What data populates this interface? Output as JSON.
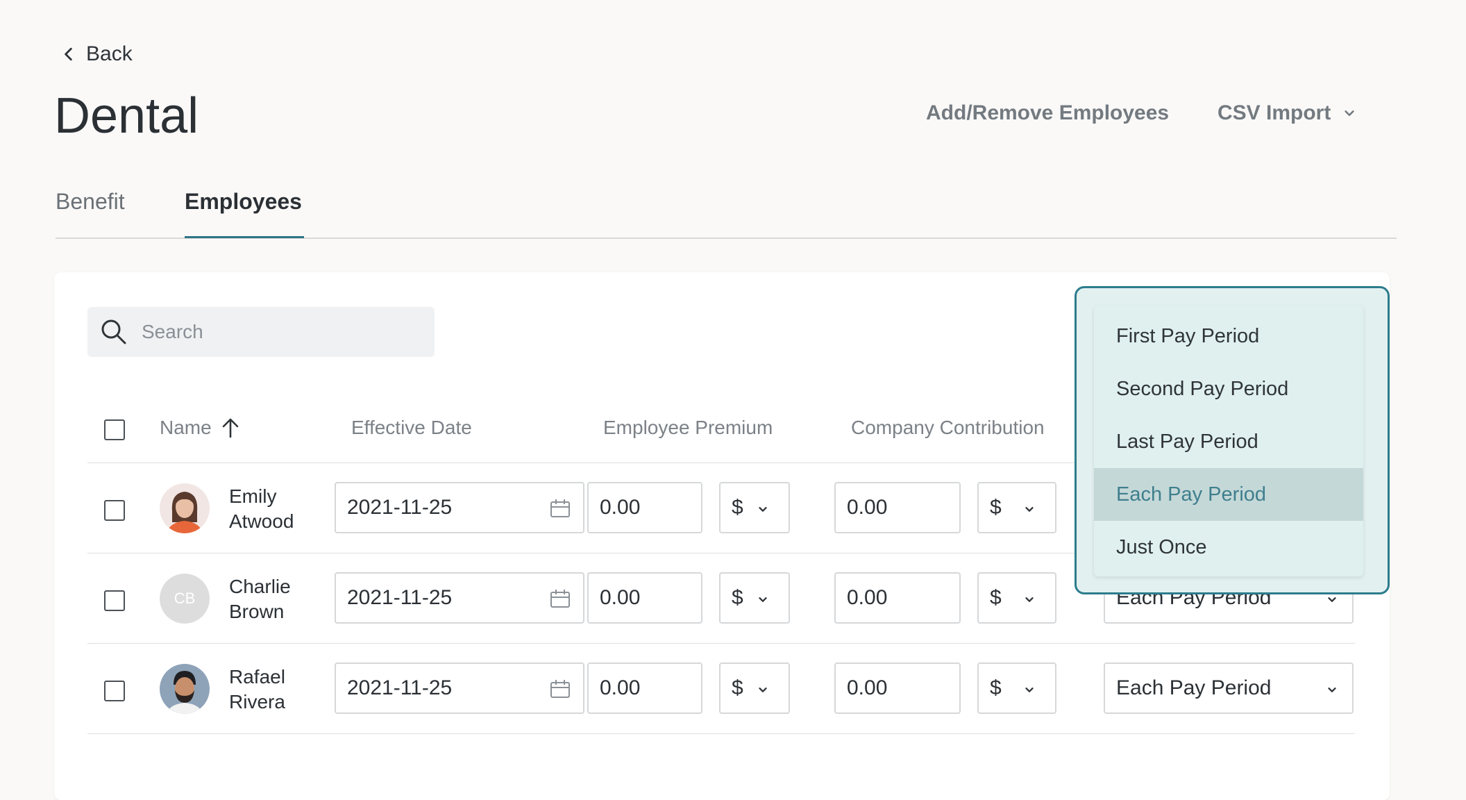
{
  "nav": {
    "back_label": "Back"
  },
  "header": {
    "title": "Dental",
    "add_remove_label": "Add/Remove Employees",
    "csv_import_label": "CSV Import"
  },
  "tabs": [
    {
      "label": "Benefit",
      "active": false
    },
    {
      "label": "Employees",
      "active": true
    }
  ],
  "search": {
    "placeholder": "Search",
    "value": ""
  },
  "table": {
    "columns": {
      "name": "Name",
      "effective_date": "Effective Date",
      "employee_premium": "Employee Premium",
      "company_contribution": "Company Contribution"
    },
    "sort_icon": "arrow-up-icon",
    "rows": [
      {
        "first": "Emily",
        "last": "Atwood",
        "avatar": "photo",
        "date": "2021-11-25",
        "premium": "0.00",
        "premium_unit": "$",
        "contribution": "0.00",
        "contribution_unit": "$",
        "frequency": "Each Pay Period"
      },
      {
        "first": "Charlie",
        "last": "Brown",
        "avatar": "initials",
        "initials": "CB",
        "date": "2021-11-25",
        "premium": "0.00",
        "premium_unit": "$",
        "contribution": "0.00",
        "contribution_unit": "$",
        "frequency": "Each Pay Period"
      },
      {
        "first": "Rafael",
        "last": "Rivera",
        "avatar": "photo",
        "date": "2021-11-25",
        "premium": "0.00",
        "premium_unit": "$",
        "contribution": "0.00",
        "contribution_unit": "$",
        "frequency": "Each Pay Period"
      }
    ]
  },
  "dropdown": {
    "options": [
      "First Pay Period",
      "Second Pay Period",
      "Last Pay Period",
      "Each Pay Period",
      "Just Once"
    ],
    "selected": "Each Pay Period"
  },
  "colors": {
    "accent": "#2c7c8c",
    "selected_option_bg": "#c5d8d8",
    "menu_bg": "#dff0ef",
    "page_bg": "#faf9f8"
  }
}
